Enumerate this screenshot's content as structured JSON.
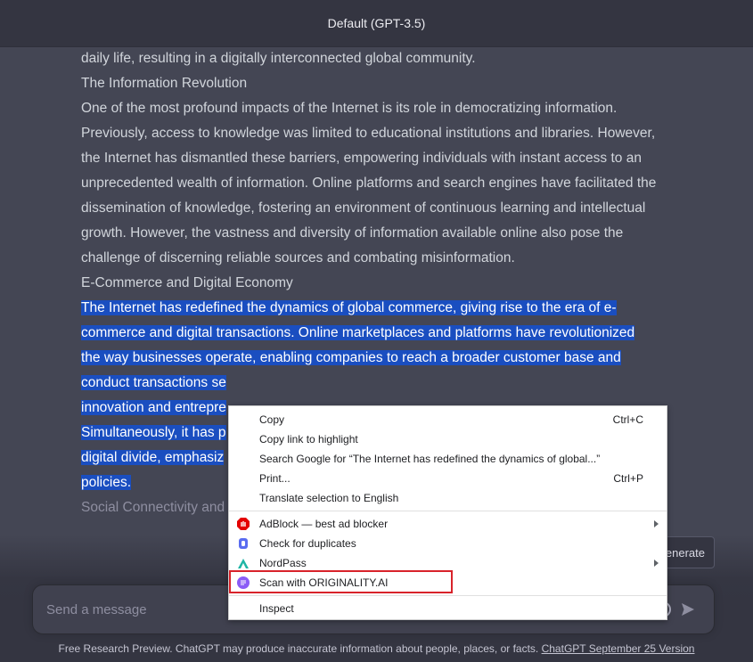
{
  "header": {
    "title": "Default (GPT-3.5)"
  },
  "article": {
    "prev_tail": "daily life, resulting in a digitally interconnected global community.",
    "sections": [
      {
        "title": "The Information Revolution",
        "body": "One of the most profound impacts of the Internet is its role in democratizing information. Previously, access to knowledge was limited to educational institutions and libraries. However, the Internet has dismantled these barriers, empowering individuals with instant access to an unprecedented wealth of information. Online platforms and search engines have facilitated the dissemination of knowledge, fostering an environment of continuous learning and intellectual growth. However, the vastness and diversity of information available online also pose the challenge of discerning reliable sources and combating misinformation."
      },
      {
        "title": "E-Commerce and Digital Economy",
        "selected_lines": [
          "The Internet has redefined the dynamics of global commerce, giving rise to the era of e-",
          "commerce and digital transactions. Online marketplaces and platforms have revolutionized",
          "the way businesses operate, enabling companies to reach a broader customer base and",
          "conduct transactions se",
          "innovation and entrepre",
          "Simultaneously, it has p",
          "digital divide, emphasiz",
          "policies."
        ]
      },
      {
        "title": "Social Connectivity and"
      }
    ]
  },
  "regenerate_label": "enerate",
  "composer": {
    "placeholder": "Send a message"
  },
  "footer": {
    "disclaimer": "Free Research Preview. ChatGPT may produce inaccurate information about people, places, or facts.",
    "version_link": "ChatGPT September 25 Version"
  },
  "context_menu": {
    "items": [
      {
        "label": "Copy",
        "shortcut": "Ctrl+C"
      },
      {
        "label": "Copy link to highlight"
      },
      {
        "label": "Search Google for “The Internet has redefined the dynamics of global...”"
      },
      {
        "label": "Print...",
        "shortcut": "Ctrl+P"
      },
      {
        "label": "Translate selection to English"
      },
      {
        "label": "AdBlock — best ad blocker",
        "icon": "adblock-icon",
        "submenu": true
      },
      {
        "label": "Check for duplicates",
        "icon": "duplicates-icon"
      },
      {
        "label": "NordPass",
        "icon": "nordpass-icon",
        "submenu": true
      },
      {
        "label": "Scan with ORIGINALITY.AI",
        "icon": "originality-icon",
        "highlighted": true
      },
      {
        "label": "Inspect"
      }
    ]
  },
  "colors": {
    "page_bg": "#444654",
    "selection": "#1a4ec0",
    "highlight_box": "#d8232a"
  }
}
